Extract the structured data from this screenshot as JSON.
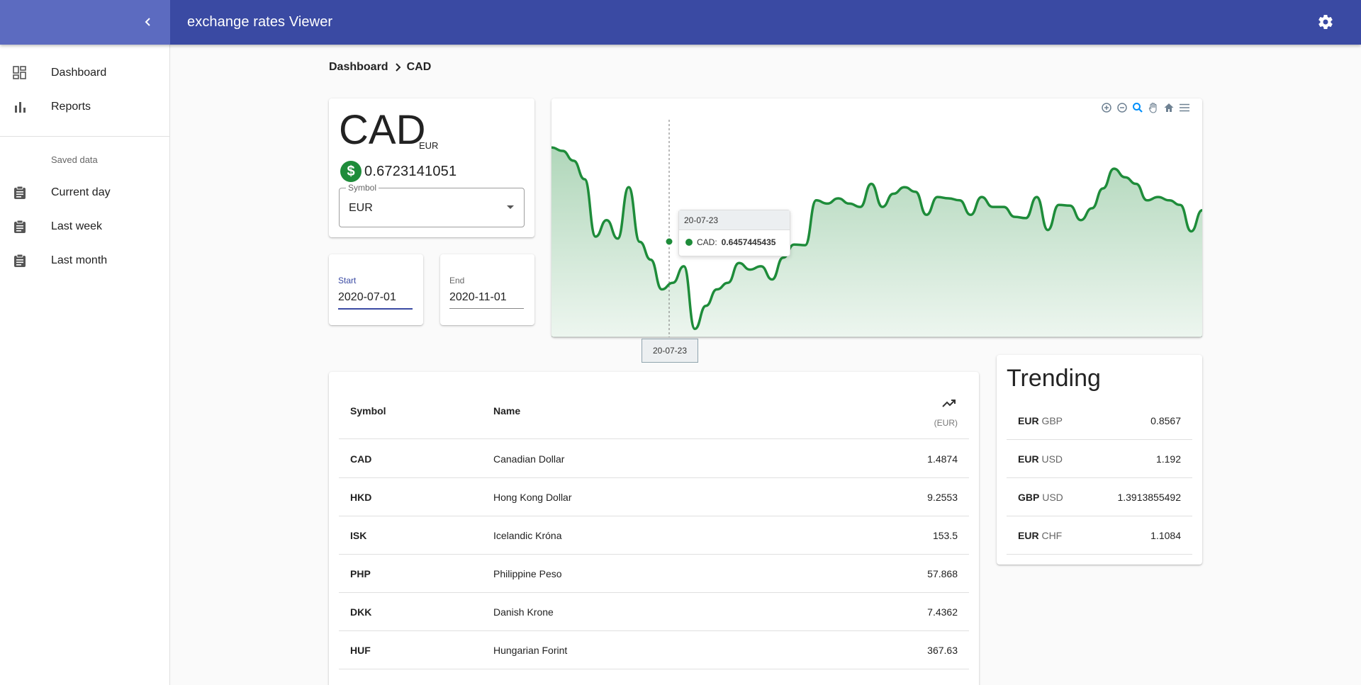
{
  "app": {
    "title": "exchange rates Viewer"
  },
  "sidebar": {
    "items": [
      {
        "label": "Dashboard",
        "icon": "dashboard-icon"
      },
      {
        "label": "Reports",
        "icon": "bar-chart-icon"
      }
    ],
    "saved_header": "Saved data",
    "saved_items": [
      {
        "label": "Current day",
        "icon": "clipboard-icon"
      },
      {
        "label": "Last week",
        "icon": "clipboard-icon"
      },
      {
        "label": "Last month",
        "icon": "clipboard-icon"
      }
    ]
  },
  "breadcrumb": {
    "root": "Dashboard",
    "current": "CAD"
  },
  "currency": {
    "code": "CAD",
    "base": "EUR",
    "value": "0.6723141051",
    "symbol_label": "Symbol",
    "symbol_value": "EUR"
  },
  "dates": {
    "start_label": "Start",
    "start_value": "2020-07-01",
    "end_label": "End",
    "end_value": "2020-11-01"
  },
  "chart_tooltip": {
    "date": "20-07-23",
    "series": "CAD:",
    "value": "0.6457445435"
  },
  "chart_xlabel": "20-07-23",
  "colors": {
    "appbar": "#3a4aa3",
    "series": "#1e8c3a",
    "drawer_head": "#5c6bc0"
  },
  "chart_data": {
    "type": "area",
    "series": [
      {
        "name": "CAD",
        "values": [
          0.66,
          0.6595,
          0.658,
          0.6552,
          0.6465,
          0.649,
          0.6462,
          0.654,
          0.6457,
          0.643,
          0.6385,
          0.6395,
          0.642,
          0.6325,
          0.636,
          0.6385,
          0.6395,
          0.6425,
          0.6415,
          0.642,
          0.64,
          0.6433,
          0.6453,
          0.6452,
          0.652,
          0.6515,
          0.6523,
          0.6515,
          0.651,
          0.6545,
          0.651,
          0.653,
          0.654,
          0.6533,
          0.6498,
          0.6525,
          0.6523,
          0.652,
          0.6498,
          0.6525,
          0.651,
          0.651,
          0.6495,
          0.6493,
          0.6525,
          0.6475,
          0.6513,
          0.6512,
          0.649,
          0.6508,
          0.6538,
          0.6568,
          0.6555,
          0.6545,
          0.652,
          0.6525,
          0.652,
          0.6513,
          0.6473,
          0.6505
        ]
      }
    ],
    "highlight": {
      "x": "20-07-23",
      "y": 0.6457445435
    },
    "xlabel": "",
    "ylabel": ""
  },
  "table": {
    "col_symbol": "Symbol",
    "col_name": "Name",
    "col_unit": "(EUR)",
    "rows": [
      {
        "symbol": "CAD",
        "name": "Canadian Dollar",
        "value": "1.4874"
      },
      {
        "symbol": "HKD",
        "name": "Hong Kong Dollar",
        "value": "9.2553"
      },
      {
        "symbol": "ISK",
        "name": "Icelandic Króna",
        "value": "153.5"
      },
      {
        "symbol": "PHP",
        "name": "Philippine Peso",
        "value": "57.868"
      },
      {
        "symbol": "DKK",
        "name": "Danish Krone",
        "value": "7.4362"
      },
      {
        "symbol": "HUF",
        "name": "Hungarian Forint",
        "value": "367.63"
      }
    ]
  },
  "trending": {
    "title": "Trending",
    "rows": [
      {
        "base": "EUR",
        "quote": "GBP",
        "rate": "0.8567"
      },
      {
        "base": "EUR",
        "quote": "USD",
        "rate": "1.192"
      },
      {
        "base": "GBP",
        "quote": "USD",
        "rate": "1.3913855492"
      },
      {
        "base": "EUR",
        "quote": "CHF",
        "rate": "1.1084"
      }
    ]
  }
}
